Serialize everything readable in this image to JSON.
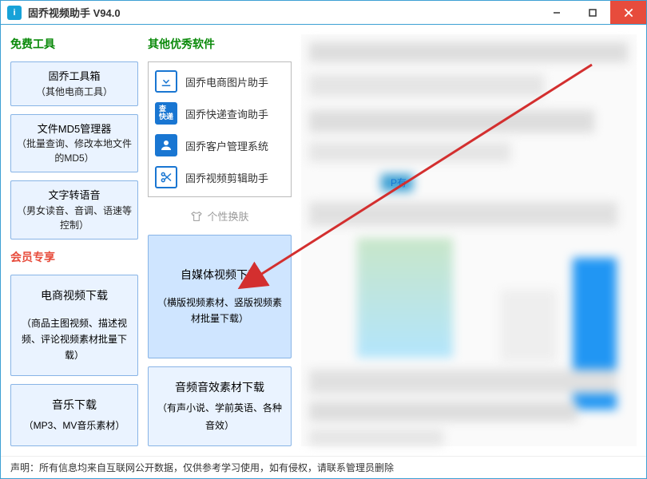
{
  "titlebar": {
    "icon_letter": "i",
    "title": "固乔视频助手 V94.0"
  },
  "left": {
    "free_title": "免费工具",
    "tools": [
      {
        "title": "固乔工具箱",
        "desc": "（其他电商工具）"
      },
      {
        "title": "文件MD5管理器",
        "desc": "（批量查询、修改本地文件的MD5）"
      },
      {
        "title": "文字转语音",
        "desc": "（男女读音、音调、语速等控制）"
      }
    ],
    "member_title": "会员专享",
    "member1": {
      "title": "电商视频下载",
      "desc": "（商品主图视频、描述视频、评论视频素材批量下载）"
    },
    "member3": {
      "title": "音乐下载",
      "desc": "（MP3、MV音乐素材）"
    }
  },
  "mid": {
    "other_title": "其他优秀软件",
    "softs": [
      {
        "label": "固乔电商图片助手",
        "icon": "download"
      },
      {
        "label": "固乔快递查询助手",
        "icon": "lookup"
      },
      {
        "label": "固乔客户管理系统",
        "icon": "user"
      },
      {
        "label": "固乔视频剪辑助手",
        "icon": "scissors"
      }
    ],
    "skin_label": "个性换肤",
    "member2": {
      "title": "自媒体视频下载",
      "desc": "（横版视频素材、竖版视频素材批量下载）"
    },
    "member4": {
      "title": "音频音效素材下载",
      "desc": "（有声小说、学前英语、各种音效）"
    }
  },
  "right": {
    "snippet": "P有"
  },
  "footer": {
    "text": "声明：所有信息均来自互联网公开数据，仅供参考学习使用，如有侵权，请联系管理员删除"
  }
}
